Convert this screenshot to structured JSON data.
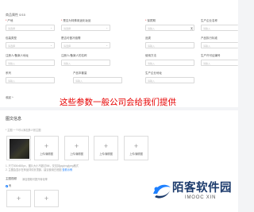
{
  "attributes": {
    "title": "商品属性 0/15",
    "fields": [
      {
        "label": "产地",
        "required": true,
        "type": "select",
        "placeholder": "请选择"
      },
      {
        "label": "是否为特殊用途化妆品",
        "required": true,
        "type": "select",
        "placeholder": "请选择"
      },
      {
        "label": "保质期",
        "required": true,
        "type": "input-unit",
        "placeholder": "请输入",
        "unit": "天"
      },
      {
        "label": "生产企业名称",
        "required": false,
        "type": "input",
        "placeholder": "请输入"
      },
      {
        "label": "包装类型",
        "required": false,
        "type": "select",
        "placeholder": "请选择"
      },
      {
        "label": "是否可做冷链需",
        "required": false,
        "type": "select",
        "placeholder": "请选择"
      },
      {
        "label": "品类",
        "required": false,
        "type": "input",
        "placeholder": "请输入"
      },
      {
        "label": "产品执行标准",
        "required": false,
        "type": "input",
        "placeholder": "请输入"
      },
      {
        "label": "注册人/备案人地址",
        "required": false,
        "type": "input",
        "placeholder": "请输入"
      },
      {
        "label": "注册人/备案人的名称",
        "required": false,
        "type": "input",
        "placeholder": "请输入"
      },
      {
        "label": "使用方法",
        "required": false,
        "type": "input",
        "placeholder": "请输入"
      },
      {
        "label": "生产许可证编号",
        "required": false,
        "type": "input",
        "placeholder": "请输入"
      },
      {
        "label": "系列",
        "required": false,
        "type": "input",
        "placeholder": "请输入"
      },
      {
        "label": "产品本套量",
        "required": false,
        "type": "input",
        "placeholder": "请输入"
      },
      {
        "label": "生产企业地址",
        "required": false,
        "type": "input",
        "placeholder": "请输入"
      }
    ],
    "collapse_label": "收起 ^",
    "annotation": "这些参数一般公司会给我们提供"
  },
  "media": {
    "title": "图文信息",
    "main_images_hint": "* 主图   一个可以添加多少张主图",
    "upload_label": "上传/编辑图",
    "note1": "1. 尺寸800x800px，图片大小不超过5M，仅支持jpg/png/jpeg格式",
    "note2": "2. 主图会显示在商品详情页顶部，建议使用白底图",
    "note2_link": "查看示例",
    "video_label": "主图视频",
    "video_hint": "添加视频可提升转化率",
    "radio_label": "有"
  },
  "watermark": {
    "title": "陌客软件园",
    "subtitle": "IMOOC XIN",
    "colors": {
      "blue": "#1e80ff",
      "dark": "#1b3a6b"
    }
  }
}
